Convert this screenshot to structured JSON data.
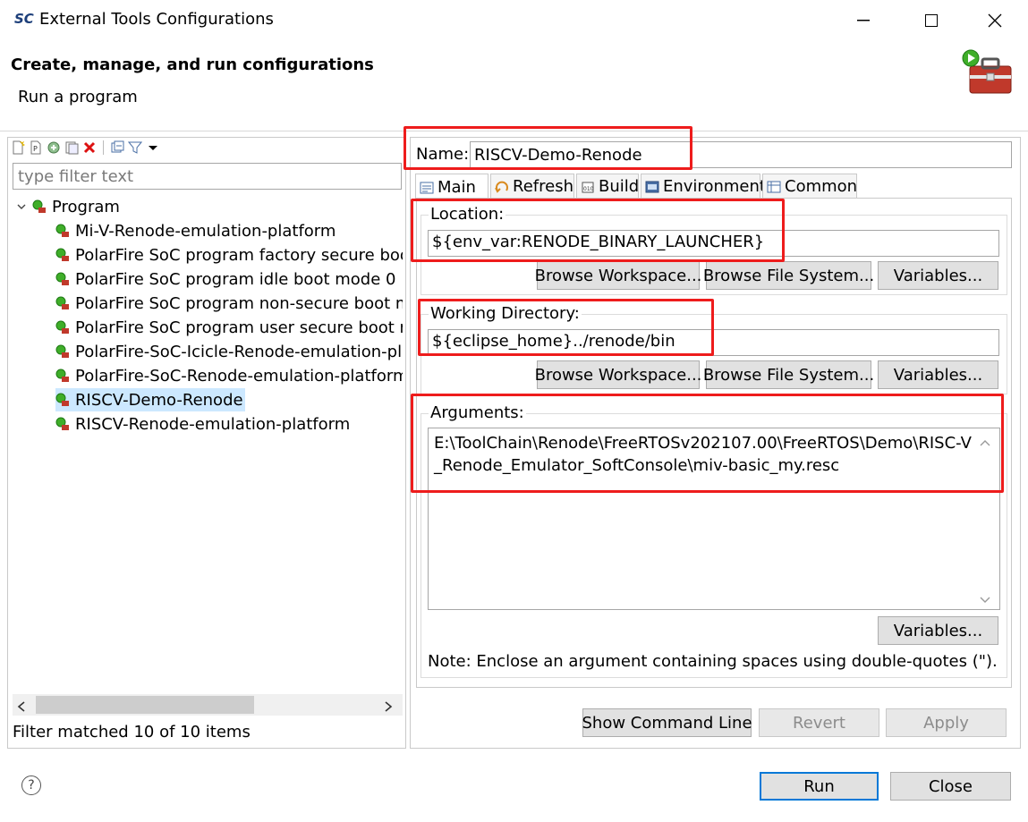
{
  "window": {
    "app_logo": "SC",
    "title": "External Tools Configurations"
  },
  "header": {
    "title": "Create, manage, and run configurations",
    "subtitle": "Run a program",
    "icon": "toolbox-run-icon"
  },
  "left": {
    "toolbar_icons": [
      "new-config-icon",
      "new-prototype-icon",
      "duplicate-icon",
      "export-icon",
      "delete-icon",
      "collapse-all-icon",
      "filter-icon",
      "view-menu-icon"
    ],
    "filter_placeholder": "type filter text",
    "tree": {
      "root_label": "Program",
      "items": [
        {
          "label": "Mi-V-Renode-emulation-platform",
          "selected": false
        },
        {
          "label": "PolarFire SoC program factory secure boot",
          "selected": false
        },
        {
          "label": "PolarFire SoC program idle boot mode 0",
          "selected": false
        },
        {
          "label": "PolarFire SoC program non-secure boot m",
          "selected": false
        },
        {
          "label": "PolarFire SoC program user secure boot m",
          "selected": false
        },
        {
          "label": "PolarFire-SoC-Icicle-Renode-emulation-pl",
          "selected": false
        },
        {
          "label": "PolarFire-SoC-Renode-emulation-platform",
          "selected": false
        },
        {
          "label": "RISCV-Demo-Renode",
          "selected": true
        },
        {
          "label": "RISCV-Renode-emulation-platform",
          "selected": false
        }
      ]
    },
    "status": "Filter matched 10 of 10 items"
  },
  "config": {
    "name_label": "Name:",
    "name_value": "RISCV-Demo-Renode",
    "tabs": [
      {
        "label": "Main",
        "icon": "main-tab-icon",
        "active": true
      },
      {
        "label": "Refresh",
        "icon": "refresh-icon",
        "active": false
      },
      {
        "label": "Build",
        "icon": "build-icon",
        "active": false
      },
      {
        "label": "Environment",
        "icon": "environment-icon",
        "active": false
      },
      {
        "label": "Common",
        "icon": "common-icon",
        "active": false
      }
    ],
    "location": {
      "label": "Location:",
      "value": "${env_var:RENODE_BINARY_LAUNCHER}",
      "browse_workspace": "Browse Workspace...",
      "browse_fs": "Browse File System...",
      "variables": "Variables..."
    },
    "working_dir": {
      "label": "Working Directory:",
      "value": "${eclipse_home}../renode/bin",
      "browse_workspace": "Browse Workspace...",
      "browse_fs": "Browse File System...",
      "variables": "Variables..."
    },
    "arguments": {
      "label": "Arguments:",
      "value": "E:\\ToolChain\\Renode\\FreeRTOSv202107.00\\FreeRTOS\\Demo\\RISC-V_Renode_Emulator_SoftConsole\\miv-basic_my.resc",
      "variables": "Variables..."
    },
    "note": "Note: Enclose an argument containing spaces using double-quotes (\")."
  },
  "actions": {
    "show_command_line": "Show Command Line",
    "revert": "Revert",
    "apply": "Apply",
    "run": "Run",
    "close": "Close"
  },
  "colors": {
    "highlight": "#ee1c1c",
    "selection": "#cce8ff",
    "default_button_border": "#0078d7"
  }
}
